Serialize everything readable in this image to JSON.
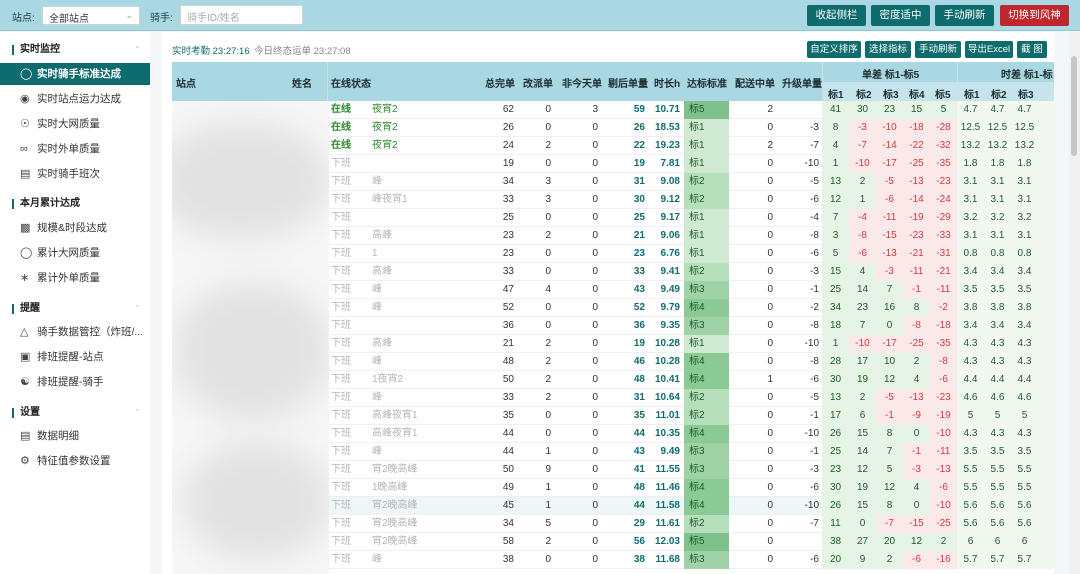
{
  "topbar": {
    "station_label": "站点:",
    "station_value": "全部站点",
    "rider_label": "骑手:",
    "rider_placeholder": "骑手ID/姓名",
    "buttons": [
      "收起侧栏",
      "密度适中",
      "手动刷新",
      "切换到风神"
    ]
  },
  "sidebar": {
    "sections": [
      {
        "title": "实时监控",
        "items": [
          "实时骑手标准达成",
          "实时站点运力达成",
          "实时大网质量",
          "实时外单质量",
          "实时骑手班次"
        ]
      },
      {
        "title": "本月累计达成",
        "items": [
          "规模&时段达成",
          "累计大网质量",
          "累计外单质量"
        ]
      },
      {
        "title": "提醒",
        "items": [
          "骑手数据管控（炸班/...",
          "排班提醒-站点",
          "排班提醒-骑手"
        ]
      },
      {
        "title": "设置",
        "items": [
          "数据明细",
          "特征值参数设置"
        ]
      }
    ],
    "active_item": "实时骑手标准达成"
  },
  "main": {
    "realtime_label": "实时考勤 23:27:16",
    "final_label": "今日终态运单 23:27:08",
    "actions": [
      "自定义排序",
      "选择指标",
      "手动刷新",
      "导出Excel",
      "截 图"
    ]
  },
  "table": {
    "headers": {
      "station": "站点",
      "name": "姓名",
      "status": "在线状态",
      "total": "总完单",
      "changed": "改派单",
      "not_today": "非今天单",
      "after": "剔后单量",
      "hours": "时长h",
      "standard": "达标标准",
      "delivering": "配送中单",
      "upgrade": "升级单量",
      "group1": "单差 标1-标5",
      "group2": "时差 标1-标",
      "sub1": [
        "标1",
        "标2",
        "标3",
        "标4",
        "标5"
      ],
      "sub2": [
        "标1",
        "标2",
        "标3"
      ]
    },
    "rows": [
      {
        "status": "在线",
        "shift": "夜宵2",
        "total": 62,
        "changed": 0,
        "not_today": 3,
        "after": 59,
        "hours": "10.71",
        "std": "标5",
        "deliv": 2,
        "upg": "",
        "d": [
          41,
          30,
          23,
          15,
          5
        ],
        "t": [
          "4.7",
          "4.7",
          "4.7"
        ]
      },
      {
        "status": "在线",
        "shift": "夜宵2",
        "total": 26,
        "changed": 0,
        "not_today": 0,
        "after": 26,
        "hours": "18.53",
        "std": "标1",
        "deliv": 0,
        "upg": -3,
        "d": [
          8,
          -3,
          -10,
          -18,
          -28
        ],
        "t": [
          "12.5",
          "12.5",
          "12.5"
        ]
      },
      {
        "status": "在线",
        "shift": "夜宵2",
        "total": 24,
        "changed": 2,
        "not_today": 0,
        "after": 22,
        "hours": "19.23",
        "std": "标1",
        "deliv": 2,
        "upg": -7,
        "d": [
          4,
          -7,
          -14,
          -22,
          -32
        ],
        "t": [
          "13.2",
          "13.2",
          "13.2"
        ]
      },
      {
        "status": "下班",
        "shift": "",
        "total": 19,
        "changed": 0,
        "not_today": 0,
        "after": 19,
        "hours": "7.81",
        "std": "标1",
        "deliv": 0,
        "upg": -10,
        "d": [
          1,
          -10,
          -17,
          -25,
          -35
        ],
        "t": [
          "1.8",
          "1.8",
          "1.8"
        ]
      },
      {
        "status": "下班",
        "shift": "峰",
        "total": 34,
        "changed": 3,
        "not_today": 0,
        "after": 31,
        "hours": "9.08",
        "std": "标2",
        "deliv": 0,
        "upg": -5,
        "d": [
          13,
          2,
          -5,
          -13,
          -23
        ],
        "t": [
          "3.1",
          "3.1",
          "3.1"
        ]
      },
      {
        "status": "下班",
        "shift": "峰夜宵1",
        "total": 33,
        "changed": 3,
        "not_today": 0,
        "after": 30,
        "hours": "9.12",
        "std": "标2",
        "deliv": 0,
        "upg": -6,
        "d": [
          12,
          1,
          -6,
          -14,
          -24
        ],
        "t": [
          "3.1",
          "3.1",
          "3.1"
        ]
      },
      {
        "status": "下班",
        "shift": "",
        "total": 25,
        "changed": 0,
        "not_today": 0,
        "after": 25,
        "hours": "9.17",
        "std": "标1",
        "deliv": 0,
        "upg": -4,
        "d": [
          7,
          -4,
          -11,
          -19,
          -29
        ],
        "t": [
          "3.2",
          "3.2",
          "3.2"
        ]
      },
      {
        "status": "下班",
        "shift": "高峰",
        "total": 23,
        "changed": 2,
        "not_today": 0,
        "after": 21,
        "hours": "9.06",
        "std": "标1",
        "deliv": 0,
        "upg": -8,
        "d": [
          3,
          -8,
          -15,
          -23,
          -33
        ],
        "t": [
          "3.1",
          "3.1",
          "3.1"
        ]
      },
      {
        "status": "下班",
        "shift": "1",
        "total": 23,
        "changed": 0,
        "not_today": 0,
        "after": 23,
        "hours": "6.76",
        "std": "标1",
        "deliv": 0,
        "upg": -6,
        "d": [
          5,
          -6,
          -13,
          -21,
          -31
        ],
        "t": [
          "0.8",
          "0.8",
          "0.8"
        ]
      },
      {
        "status": "下班",
        "shift": "高峰",
        "total": 33,
        "changed": 0,
        "not_today": 0,
        "after": 33,
        "hours": "9.41",
        "std": "标2",
        "deliv": 0,
        "upg": -3,
        "d": [
          15,
          4,
          -3,
          -11,
          -21
        ],
        "t": [
          "3.4",
          "3.4",
          "3.4"
        ]
      },
      {
        "status": "下班",
        "shift": "峰",
        "total": 47,
        "changed": 4,
        "not_today": 0,
        "after": 43,
        "hours": "9.49",
        "std": "标3",
        "deliv": 0,
        "upg": -1,
        "d": [
          25,
          14,
          7,
          -1,
          -11
        ],
        "t": [
          "3.5",
          "3.5",
          "3.5"
        ]
      },
      {
        "status": "下班",
        "shift": "峰",
        "total": 52,
        "changed": 0,
        "not_today": 0,
        "after": 52,
        "hours": "9.79",
        "std": "标4",
        "deliv": 0,
        "upg": -2,
        "d": [
          34,
          23,
          16,
          8,
          -2
        ],
        "t": [
          "3.8",
          "3.8",
          "3.8"
        ]
      },
      {
        "status": "下班",
        "shift": "",
        "total": 36,
        "changed": 0,
        "not_today": 0,
        "after": 36,
        "hours": "9.35",
        "std": "标3",
        "deliv": 0,
        "upg": -8,
        "d": [
          18,
          7,
          0,
          -8,
          -18
        ],
        "t": [
          "3.4",
          "3.4",
          "3.4"
        ]
      },
      {
        "status": "下班",
        "shift": "高峰",
        "total": 21,
        "changed": 2,
        "not_today": 0,
        "after": 19,
        "hours": "10.28",
        "std": "标1",
        "deliv": 0,
        "upg": -10,
        "d": [
          1,
          -10,
          -17,
          -25,
          -35
        ],
        "t": [
          "4.3",
          "4.3",
          "4.3"
        ]
      },
      {
        "status": "下班",
        "shift": "峰",
        "total": 48,
        "changed": 2,
        "not_today": 0,
        "after": 46,
        "hours": "10.28",
        "std": "标4",
        "deliv": 0,
        "upg": -8,
        "d": [
          28,
          17,
          10,
          2,
          -8
        ],
        "t": [
          "4.3",
          "4.3",
          "4.3"
        ]
      },
      {
        "status": "下班",
        "shift": "1夜宵2",
        "total": 50,
        "changed": 2,
        "not_today": 0,
        "after": 48,
        "hours": "10.41",
        "std": "标4",
        "deliv": 1,
        "upg": -6,
        "d": [
          30,
          19,
          12,
          4,
          -6
        ],
        "t": [
          "4.4",
          "4.4",
          "4.4"
        ]
      },
      {
        "status": "下班",
        "shift": "峰",
        "total": 33,
        "changed": 2,
        "not_today": 0,
        "after": 31,
        "hours": "10.64",
        "std": "标2",
        "deliv": 0,
        "upg": -5,
        "d": [
          13,
          2,
          -5,
          -13,
          -23
        ],
        "t": [
          "4.6",
          "4.6",
          "4.6"
        ]
      },
      {
        "status": "下班",
        "shift": "高峰夜宵1",
        "total": 35,
        "changed": 0,
        "not_today": 0,
        "after": 35,
        "hours": "11.01",
        "std": "标2",
        "deliv": 0,
        "upg": -1,
        "d": [
          17,
          6,
          -1,
          -9,
          -19
        ],
        "t": [
          "5",
          "5",
          "5"
        ]
      },
      {
        "status": "下班",
        "shift": "高峰夜宵1",
        "total": 44,
        "changed": 0,
        "not_today": 0,
        "after": 44,
        "hours": "10.35",
        "std": "标4",
        "deliv": 0,
        "upg": -10,
        "d": [
          26,
          15,
          8,
          0,
          -10
        ],
        "t": [
          "4.3",
          "4.3",
          "4.3"
        ]
      },
      {
        "status": "下班",
        "shift": "峰",
        "total": 44,
        "changed": 1,
        "not_today": 0,
        "after": 43,
        "hours": "9.49",
        "std": "标3",
        "deliv": 0,
        "upg": -1,
        "d": [
          25,
          14,
          7,
          -1,
          -11
        ],
        "t": [
          "3.5",
          "3.5",
          "3.5"
        ]
      },
      {
        "status": "下班",
        "shift": "宵2晚高峰",
        "total": 50,
        "changed": 9,
        "not_today": 0,
        "after": 41,
        "hours": "11.55",
        "std": "标3",
        "deliv": 0,
        "upg": -3,
        "d": [
          23,
          12,
          5,
          -3,
          -13
        ],
        "t": [
          "5.5",
          "5.5",
          "5.5"
        ]
      },
      {
        "status": "下班",
        "shift": "1晚高峰",
        "total": 49,
        "changed": 1,
        "not_today": 0,
        "after": 48,
        "hours": "11.46",
        "std": "标4",
        "deliv": 0,
        "upg": -6,
        "d": [
          30,
          19,
          12,
          4,
          -6
        ],
        "t": [
          "5.5",
          "5.5",
          "5.5"
        ]
      },
      {
        "status": "下班",
        "shift": "宵2晚高峰",
        "total": 45,
        "changed": 1,
        "not_today": 0,
        "after": 44,
        "hours": "11.58",
        "std": "标4",
        "deliv": 0,
        "upg": -10,
        "d": [
          26,
          15,
          8,
          0,
          -10
        ],
        "t": [
          "5.6",
          "5.6",
          "5.6"
        ]
      },
      {
        "status": "下班",
        "shift": "宵2晚高峰",
        "total": 34,
        "changed": 5,
        "not_today": 0,
        "after": 29,
        "hours": "11.61",
        "std": "标2",
        "deliv": 0,
        "upg": -7,
        "d": [
          11,
          0,
          -7,
          -15,
          -25
        ],
        "t": [
          "5.6",
          "5.6",
          "5.6"
        ]
      },
      {
        "status": "下班",
        "shift": "宵2晚高峰",
        "total": 58,
        "changed": 2,
        "not_today": 0,
        "after": 56,
        "hours": "12.03",
        "std": "标5",
        "deliv": 0,
        "upg": "",
        "d": [
          38,
          27,
          20,
          12,
          2
        ],
        "t": [
          "6",
          "6",
          "6"
        ]
      },
      {
        "status": "下班",
        "shift": "峰",
        "total": 38,
        "changed": 0,
        "not_today": 0,
        "after": 38,
        "hours": "11.68",
        "std": "标3",
        "deliv": 0,
        "upg": -6,
        "d": [
          20,
          9,
          2,
          -6,
          -16
        ],
        "t": [
          "5.7",
          "5.7",
          "5.7"
        ]
      }
    ]
  },
  "colors": {
    "accent": "#0f6c6e",
    "header_bg": "#a9d8e2",
    "danger_button": "#c0262d",
    "online_text": "#2e8b2e",
    "negative_text": "#d13b3b",
    "std1": "#cfe9d3",
    "std2": "#b5dfbb",
    "std3": "#9fd3a7",
    "std4": "#8bc995",
    "std5": "#7fc18a"
  },
  "icons": {
    "sidebar": [
      "user-icon",
      "location-pin-icon",
      "globe-icon",
      "link-icon",
      "calendar-icon",
      "bar-chart-icon",
      "shield-icon",
      "share-icon",
      "warning-icon",
      "bank-icon",
      "users-icon",
      "list-icon",
      "gear-icon"
    ]
  }
}
